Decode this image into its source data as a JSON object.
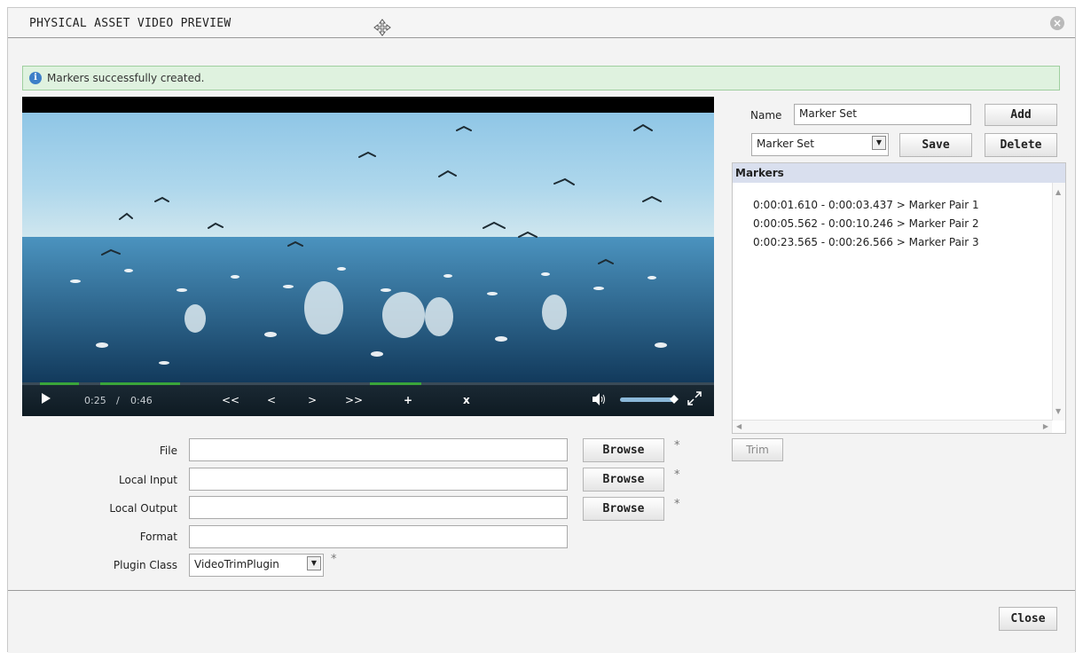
{
  "window": {
    "title": "PHYSICAL ASSET VIDEO PREVIEW"
  },
  "message": {
    "text": "Markers successfully created."
  },
  "player": {
    "current_time": "0:25",
    "separator": "/",
    "duration": "0:46",
    "rewind_label": "<<",
    "prev_label": "<",
    "next_label": ">",
    "forward_label": ">>",
    "add_label": "+",
    "remove_label": "x",
    "progress_fraction": 0.54
  },
  "markers_panel": {
    "name_label": "Name",
    "name_value": "Marker Set",
    "add_label": "Add",
    "set_select_value": "Marker Set",
    "save_label": "Save",
    "delete_label": "Delete",
    "header": "Markers",
    "items": [
      "0:00:01.610 - 0:00:03.437 > Marker Pair 1",
      "0:00:05.562 - 0:00:10.246 > Marker Pair 2",
      "0:00:23.565 - 0:00:26.566 > Marker Pair 3"
    ],
    "trim_label": "Trim"
  },
  "form": {
    "file_label": "File",
    "file_value": "",
    "local_input_label": "Local Input",
    "local_input_value": "",
    "local_output_label": "Local Output",
    "local_output_value": "",
    "format_label": "Format",
    "format_value": "",
    "plugin_class_label": "Plugin Class",
    "plugin_class_value": "VideoTrimPlugin",
    "browse_label": "Browse",
    "required_mark": "*"
  },
  "footer": {
    "close_label": "Close"
  },
  "colors": {
    "message_bg": "#dff2df",
    "header_bg": "#d9dfee",
    "seek_green": "#3aa53a"
  }
}
